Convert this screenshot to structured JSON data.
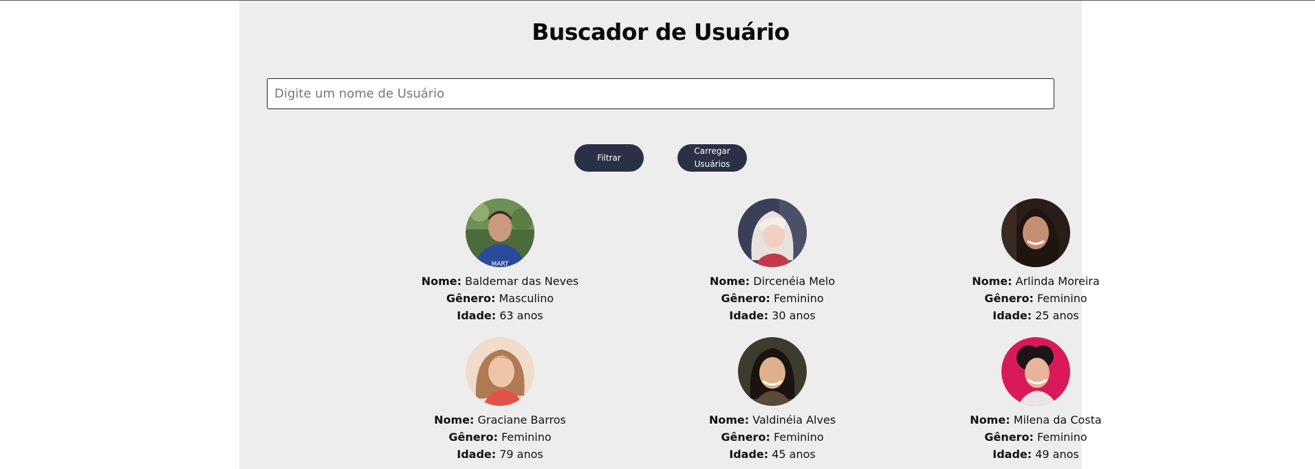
{
  "page": {
    "title": "Buscador de Usuário"
  },
  "search": {
    "placeholder": "Digite um nome de Usuário",
    "value": ""
  },
  "buttons": {
    "filter_label": "Filtrar",
    "load_label": "Carregar Usuários"
  },
  "labels": {
    "name": "Nome:",
    "gender": "Gênero:",
    "age": "Idade:"
  },
  "users": [
    {
      "name": "Baldemar das Neves",
      "gender": "Masculino",
      "age": "63 anos"
    },
    {
      "name": "Dircenéia Melo",
      "gender": "Feminino",
      "age": "30 anos"
    },
    {
      "name": "Arlinda Moreira",
      "gender": "Feminino",
      "age": "25 anos"
    },
    {
      "name": "Graciane Barros",
      "gender": "Feminino",
      "age": "79 anos"
    },
    {
      "name": "Valdinéia Alves",
      "gender": "Feminino",
      "age": "45 anos"
    },
    {
      "name": "Milena da Costa",
      "gender": "Feminino",
      "age": "49 anos"
    }
  ],
  "colors": {
    "panel_bg": "#ededed",
    "button_bg": "#2b3047",
    "button_text": "#ffffff"
  }
}
